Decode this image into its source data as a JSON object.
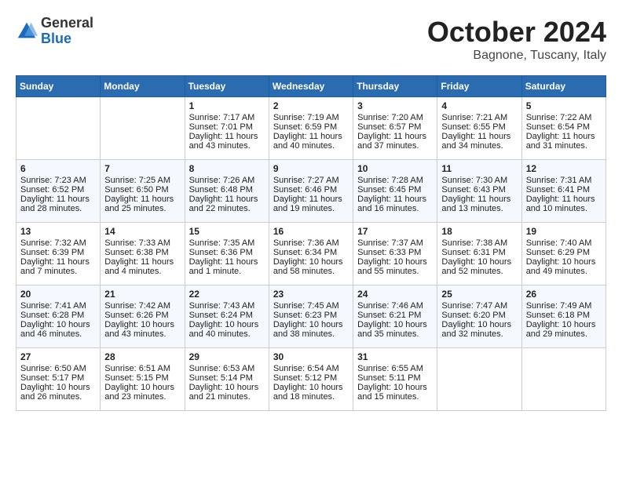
{
  "header": {
    "logo_general": "General",
    "logo_blue": "Blue",
    "month": "October 2024",
    "location": "Bagnone, Tuscany, Italy"
  },
  "days_of_week": [
    "Sunday",
    "Monday",
    "Tuesday",
    "Wednesday",
    "Thursday",
    "Friday",
    "Saturday"
  ],
  "weeks": [
    [
      {
        "day": "",
        "sunrise": "",
        "sunset": "",
        "daylight": ""
      },
      {
        "day": "",
        "sunrise": "",
        "sunset": "",
        "daylight": ""
      },
      {
        "day": "1",
        "sunrise": "Sunrise: 7:17 AM",
        "sunset": "Sunset: 7:01 PM",
        "daylight": "Daylight: 11 hours and 43 minutes."
      },
      {
        "day": "2",
        "sunrise": "Sunrise: 7:19 AM",
        "sunset": "Sunset: 6:59 PM",
        "daylight": "Daylight: 11 hours and 40 minutes."
      },
      {
        "day": "3",
        "sunrise": "Sunrise: 7:20 AM",
        "sunset": "Sunset: 6:57 PM",
        "daylight": "Daylight: 11 hours and 37 minutes."
      },
      {
        "day": "4",
        "sunrise": "Sunrise: 7:21 AM",
        "sunset": "Sunset: 6:55 PM",
        "daylight": "Daylight: 11 hours and 34 minutes."
      },
      {
        "day": "5",
        "sunrise": "Sunrise: 7:22 AM",
        "sunset": "Sunset: 6:54 PM",
        "daylight": "Daylight: 11 hours and 31 minutes."
      }
    ],
    [
      {
        "day": "6",
        "sunrise": "Sunrise: 7:23 AM",
        "sunset": "Sunset: 6:52 PM",
        "daylight": "Daylight: 11 hours and 28 minutes."
      },
      {
        "day": "7",
        "sunrise": "Sunrise: 7:25 AM",
        "sunset": "Sunset: 6:50 PM",
        "daylight": "Daylight: 11 hours and 25 minutes."
      },
      {
        "day": "8",
        "sunrise": "Sunrise: 7:26 AM",
        "sunset": "Sunset: 6:48 PM",
        "daylight": "Daylight: 11 hours and 22 minutes."
      },
      {
        "day": "9",
        "sunrise": "Sunrise: 7:27 AM",
        "sunset": "Sunset: 6:46 PM",
        "daylight": "Daylight: 11 hours and 19 minutes."
      },
      {
        "day": "10",
        "sunrise": "Sunrise: 7:28 AM",
        "sunset": "Sunset: 6:45 PM",
        "daylight": "Daylight: 11 hours and 16 minutes."
      },
      {
        "day": "11",
        "sunrise": "Sunrise: 7:30 AM",
        "sunset": "Sunset: 6:43 PM",
        "daylight": "Daylight: 11 hours and 13 minutes."
      },
      {
        "day": "12",
        "sunrise": "Sunrise: 7:31 AM",
        "sunset": "Sunset: 6:41 PM",
        "daylight": "Daylight: 11 hours and 10 minutes."
      }
    ],
    [
      {
        "day": "13",
        "sunrise": "Sunrise: 7:32 AM",
        "sunset": "Sunset: 6:39 PM",
        "daylight": "Daylight: 11 hours and 7 minutes."
      },
      {
        "day": "14",
        "sunrise": "Sunrise: 7:33 AM",
        "sunset": "Sunset: 6:38 PM",
        "daylight": "Daylight: 11 hours and 4 minutes."
      },
      {
        "day": "15",
        "sunrise": "Sunrise: 7:35 AM",
        "sunset": "Sunset: 6:36 PM",
        "daylight": "Daylight: 11 hours and 1 minute."
      },
      {
        "day": "16",
        "sunrise": "Sunrise: 7:36 AM",
        "sunset": "Sunset: 6:34 PM",
        "daylight": "Daylight: 10 hours and 58 minutes."
      },
      {
        "day": "17",
        "sunrise": "Sunrise: 7:37 AM",
        "sunset": "Sunset: 6:33 PM",
        "daylight": "Daylight: 10 hours and 55 minutes."
      },
      {
        "day": "18",
        "sunrise": "Sunrise: 7:38 AM",
        "sunset": "Sunset: 6:31 PM",
        "daylight": "Daylight: 10 hours and 52 minutes."
      },
      {
        "day": "19",
        "sunrise": "Sunrise: 7:40 AM",
        "sunset": "Sunset: 6:29 PM",
        "daylight": "Daylight: 10 hours and 49 minutes."
      }
    ],
    [
      {
        "day": "20",
        "sunrise": "Sunrise: 7:41 AM",
        "sunset": "Sunset: 6:28 PM",
        "daylight": "Daylight: 10 hours and 46 minutes."
      },
      {
        "day": "21",
        "sunrise": "Sunrise: 7:42 AM",
        "sunset": "Sunset: 6:26 PM",
        "daylight": "Daylight: 10 hours and 43 minutes."
      },
      {
        "day": "22",
        "sunrise": "Sunrise: 7:43 AM",
        "sunset": "Sunset: 6:24 PM",
        "daylight": "Daylight: 10 hours and 40 minutes."
      },
      {
        "day": "23",
        "sunrise": "Sunrise: 7:45 AM",
        "sunset": "Sunset: 6:23 PM",
        "daylight": "Daylight: 10 hours and 38 minutes."
      },
      {
        "day": "24",
        "sunrise": "Sunrise: 7:46 AM",
        "sunset": "Sunset: 6:21 PM",
        "daylight": "Daylight: 10 hours and 35 minutes."
      },
      {
        "day": "25",
        "sunrise": "Sunrise: 7:47 AM",
        "sunset": "Sunset: 6:20 PM",
        "daylight": "Daylight: 10 hours and 32 minutes."
      },
      {
        "day": "26",
        "sunrise": "Sunrise: 7:49 AM",
        "sunset": "Sunset: 6:18 PM",
        "daylight": "Daylight: 10 hours and 29 minutes."
      }
    ],
    [
      {
        "day": "27",
        "sunrise": "Sunrise: 6:50 AM",
        "sunset": "Sunset: 5:17 PM",
        "daylight": "Daylight: 10 hours and 26 minutes."
      },
      {
        "day": "28",
        "sunrise": "Sunrise: 6:51 AM",
        "sunset": "Sunset: 5:15 PM",
        "daylight": "Daylight: 10 hours and 23 minutes."
      },
      {
        "day": "29",
        "sunrise": "Sunrise: 6:53 AM",
        "sunset": "Sunset: 5:14 PM",
        "daylight": "Daylight: 10 hours and 21 minutes."
      },
      {
        "day": "30",
        "sunrise": "Sunrise: 6:54 AM",
        "sunset": "Sunset: 5:12 PM",
        "daylight": "Daylight: 10 hours and 18 minutes."
      },
      {
        "day": "31",
        "sunrise": "Sunrise: 6:55 AM",
        "sunset": "Sunset: 5:11 PM",
        "daylight": "Daylight: 10 hours and 15 minutes."
      },
      {
        "day": "",
        "sunrise": "",
        "sunset": "",
        "daylight": ""
      },
      {
        "day": "",
        "sunrise": "",
        "sunset": "",
        "daylight": ""
      }
    ]
  ]
}
